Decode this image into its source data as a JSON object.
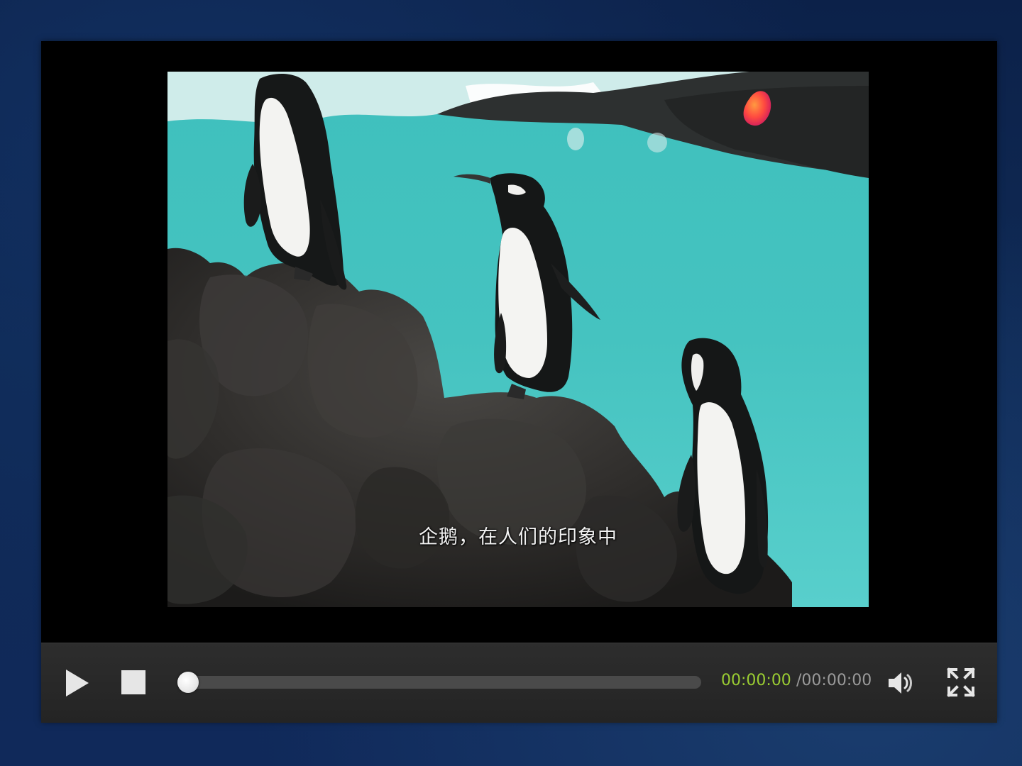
{
  "video": {
    "subtitle": "企鹅，在人们的印象中"
  },
  "controls": {
    "play_icon": "play-icon",
    "stop_icon": "stop-icon",
    "volume_icon": "volume-icon",
    "fullscreen_icon": "fullscreen-icon",
    "progress_fraction": 0.02,
    "current_time": "00:00:00",
    "total_time": "/00:00:00"
  },
  "colors": {
    "current_time": "#9acd32",
    "total_time": "#9a9a9a",
    "control_bar": "#2a2a2a",
    "page_background": "#0f2a55"
  }
}
